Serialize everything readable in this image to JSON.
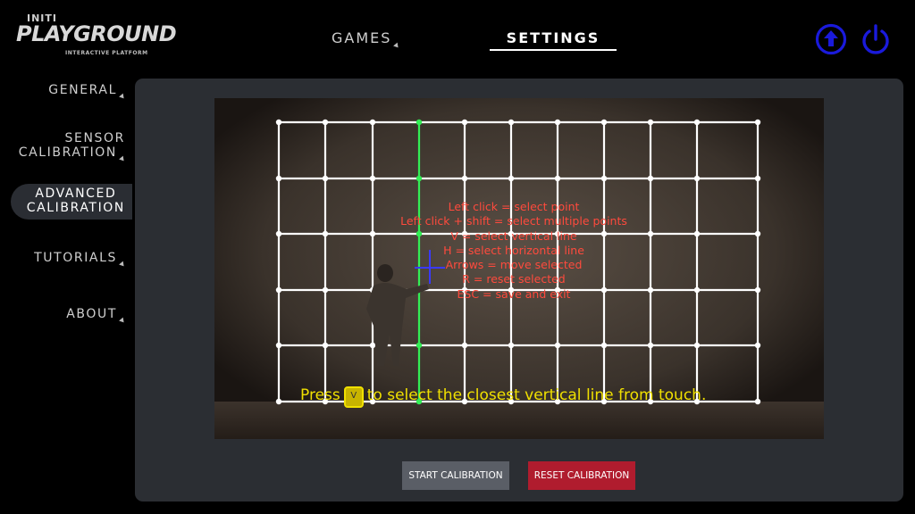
{
  "logo": {
    "top": "INITI",
    "main": "PLAYGROUND",
    "sub": "INTERACTIVE PLATFORM"
  },
  "nav": {
    "games": "GAMES",
    "settings": "SETTINGS"
  },
  "header_icons": {
    "upload": "upload-icon",
    "power": "power-icon",
    "color": "#1a1adb"
  },
  "sidebar": {
    "items": [
      {
        "lines": [
          "GENERAL"
        ]
      },
      {
        "lines": [
          "SENSOR",
          "CALIBRATION"
        ]
      },
      {
        "lines": [
          "ADVANCED",
          "CALIBRATION"
        ]
      },
      {
        "lines": [
          "TUTORIALS"
        ]
      },
      {
        "lines": [
          "ABOUT"
        ]
      }
    ],
    "active_index": 2
  },
  "instructions": [
    "Left click = select point",
    "Left click + shift = select multiple points",
    "V = select vertical line",
    "H = select horizontal line",
    "Arrows = move selected",
    "R = reset selected",
    "ESC = save and exit"
  ],
  "hint": {
    "before": "Press",
    "key": "V",
    "after": "to select the closest vertical line from touch."
  },
  "buttons": {
    "start": "START CALIBRATION",
    "reset": "RESET CALIBRATION"
  },
  "colors": {
    "grid": "#ffffff",
    "selected_line": "#33ee55",
    "instruction": "#ff4a3d",
    "hint": "#f0e000",
    "reset": "#b01c2e"
  }
}
